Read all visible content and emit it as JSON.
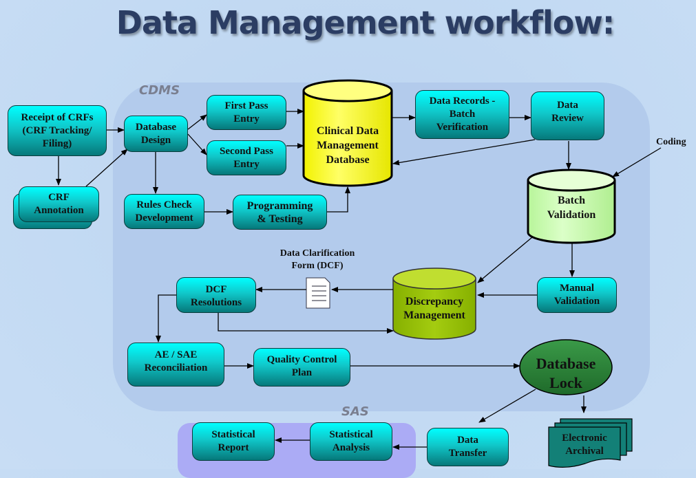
{
  "title": "Data Management workflow:",
  "regions": {
    "cdms": "CDMS",
    "sas": "SAS"
  },
  "nodes": {
    "receipt": "Receipt of CRFs\n(CRF Tracking/\nFiling)",
    "crf_annotation": "CRF\nAnnotation",
    "database_design": "Database\nDesign",
    "first_pass": "First Pass\nEntry",
    "second_pass": "Second Pass\nEntry",
    "rules_check": "Rules Check\nDevelopment",
    "programming": "Programming\n& Testing",
    "clinical_db": "Clinical Data\nManagement\nDatabase",
    "batch_verification": "Data Records -\nBatch\nVerification",
    "data_review": "Data\nReview",
    "batch_validation": "Batch\nValidation",
    "manual_validation": "Manual\nValidation",
    "discrepancy": "Discrepancy\nManagement",
    "dcf_resolutions": "DCF\nResolutions",
    "ae_sae": "AE / SAE\nReconciliation",
    "qc_plan": "Quality Control\nPlan",
    "database_lock": "Database\nLock",
    "data_transfer": "Data\nTransfer",
    "electronic_archival": "Electronic\nArchival",
    "statistical_analysis": "Statistical\nAnalysis",
    "statistical_report": "Statistical\nReport"
  },
  "labels": {
    "coding": "Coding",
    "dcf_form": "Data Clarification\nForm   (DCF)"
  },
  "icons": {
    "dcf_document": "document-icon"
  },
  "colors": {
    "box_top": "#00ffff",
    "box_bottom": "#06787a",
    "clinical_db": "#ffff33",
    "batch_validation": "#ccffb0",
    "discrepancy": "#99c400",
    "database_lock": "#2e8b3e",
    "archival": "#138077",
    "title": "#2b3d63"
  }
}
